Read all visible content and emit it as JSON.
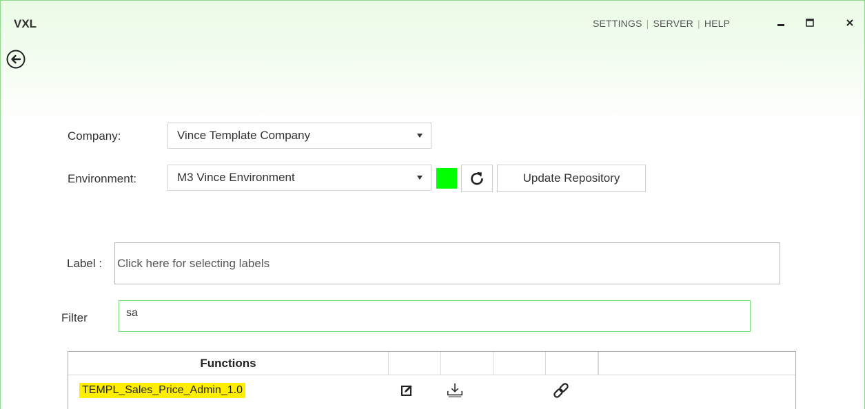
{
  "app": {
    "title": "VXL"
  },
  "top_nav": {
    "items": [
      "SETTINGS",
      "SERVER",
      "HELP"
    ],
    "separator": "|"
  },
  "window_controls": {
    "icons": [
      "minimize-icon",
      "maximize-icon",
      "close-icon"
    ]
  },
  "back": {
    "icon": "arrow-left-circle-icon"
  },
  "form": {
    "company_label": "Company:",
    "company_value": "Vince Template Company",
    "environment_label": "Environment:",
    "environment_value": "M3 Vince Environment",
    "status_color": "#00ff00",
    "refresh_icon": "refresh-icon",
    "update_button": "Update Repository",
    "label_label": "Label :",
    "label_placeholder": "Click here for selecting labels",
    "filter_label": "Filter",
    "filter_value": "sa"
  },
  "table": {
    "headers": [
      "Functions",
      "",
      "",
      "",
      "",
      ""
    ],
    "rows": [
      {
        "name": "TEMPL_Sales_Price_Admin_1.0",
        "highlight_color": "#ffee00",
        "icons": [
          "edit-icon",
          "download-icon",
          "link-icon"
        ]
      }
    ]
  },
  "colors": {
    "accent_border": "#7bd97b",
    "highlight": "#ffee00",
    "status_ok": "#00ff00"
  }
}
